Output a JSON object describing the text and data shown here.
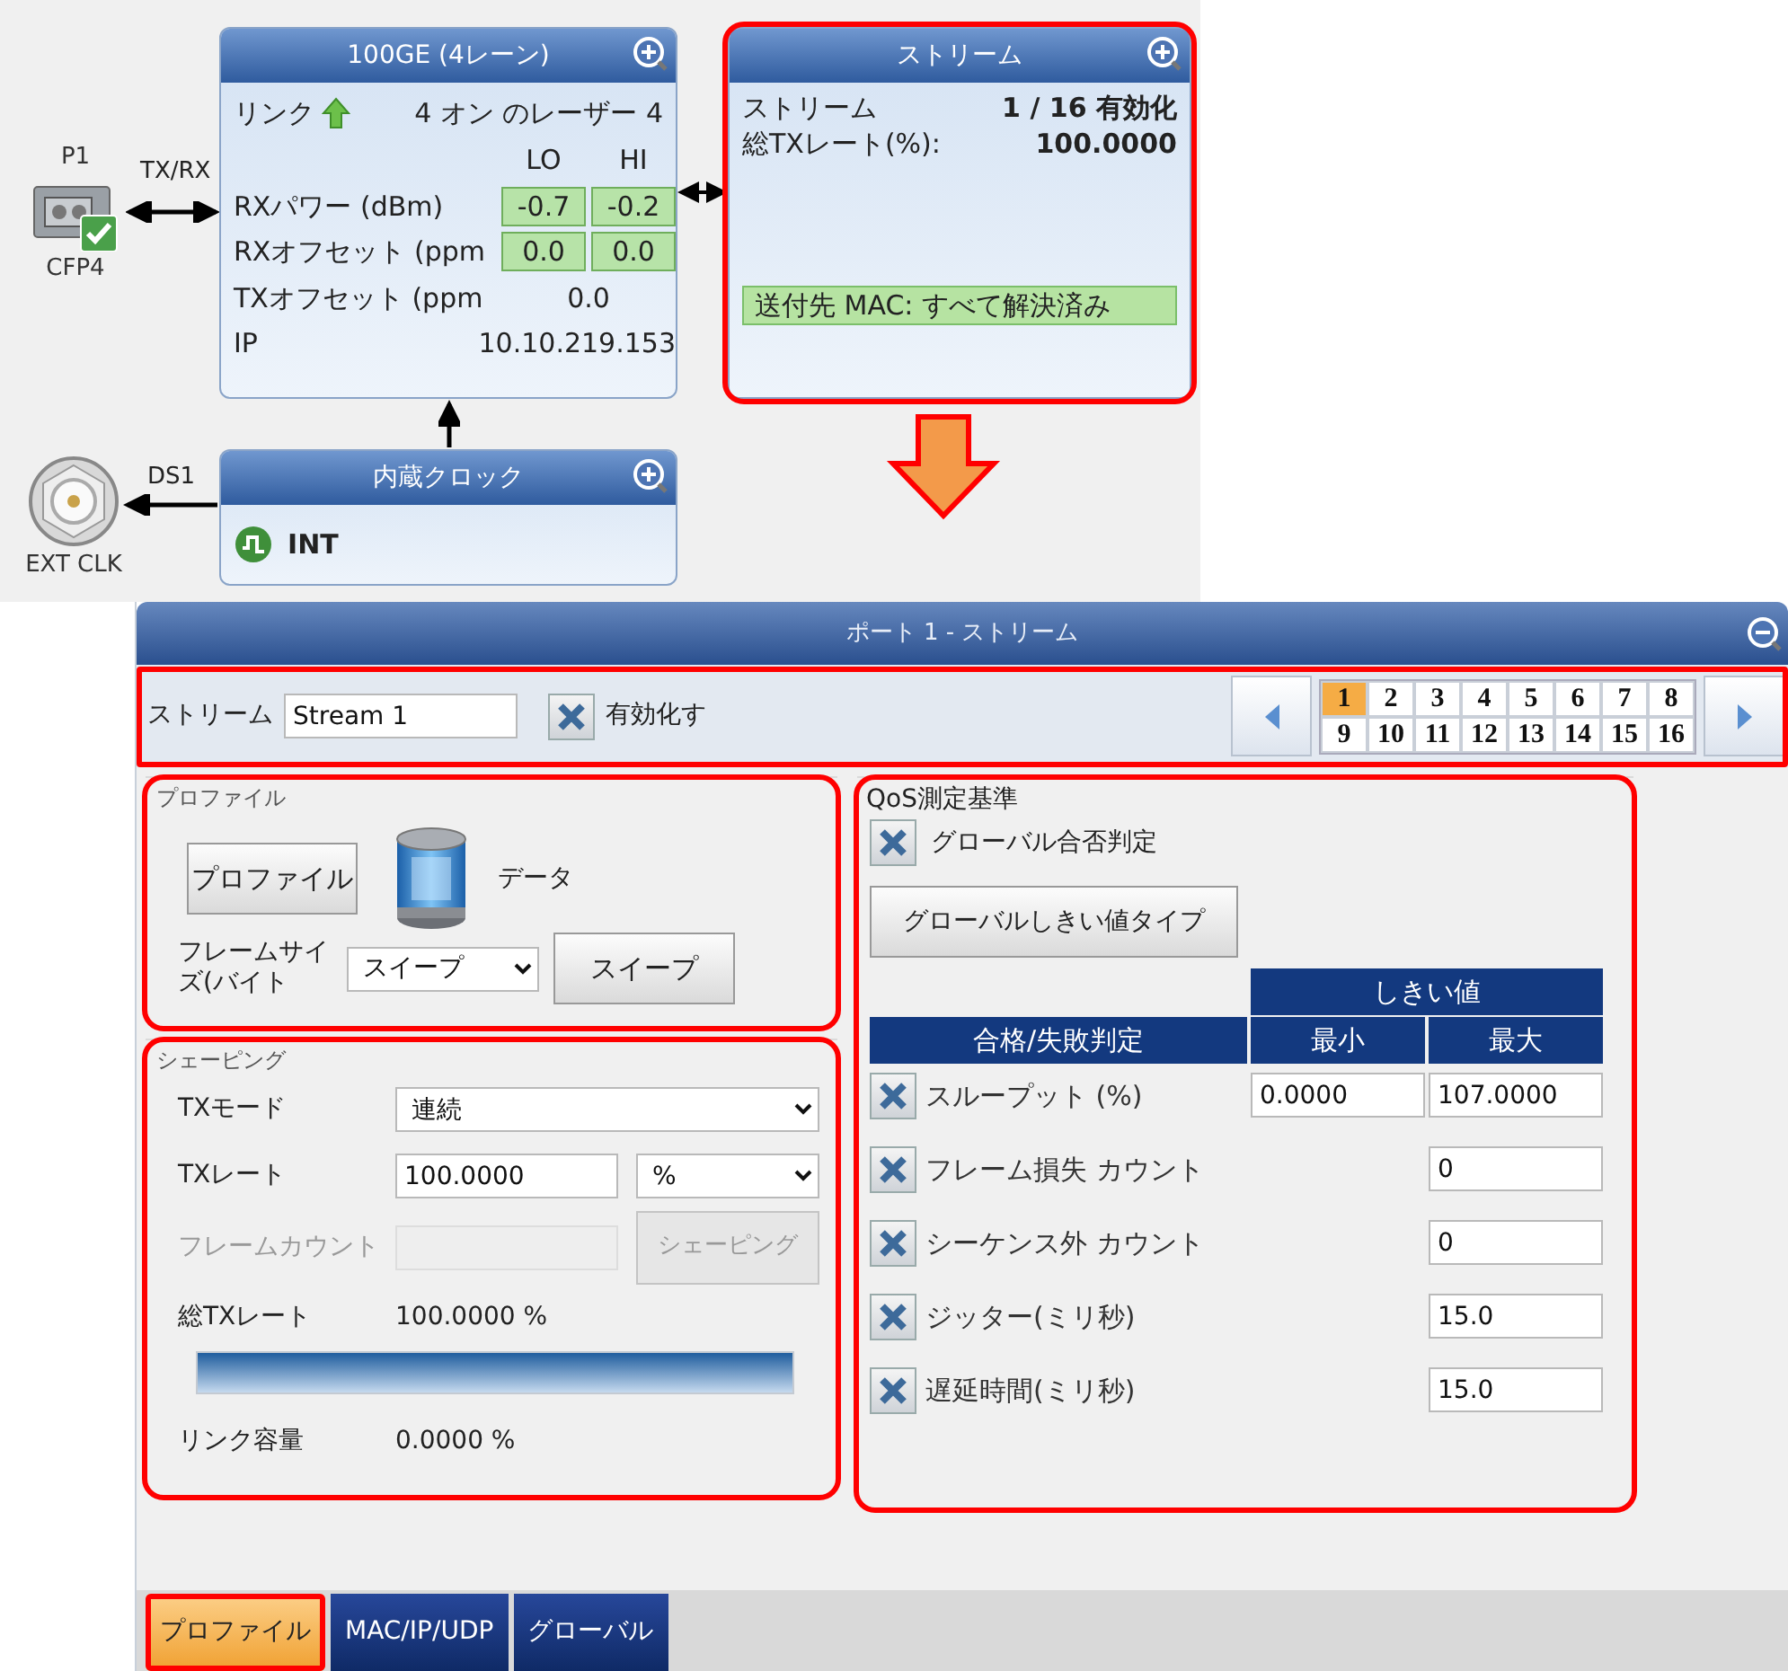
{
  "diagram": {
    "port": {
      "label": "P1",
      "type": "CFP4",
      "link": "TX/RX"
    },
    "interface": {
      "title": "100GE (4レーン)",
      "link_label": "リンク",
      "lasers": "4 オン のレーザー 4",
      "columns": [
        "LO",
        "HI"
      ],
      "rows": [
        {
          "label": "RXパワー (dBm)",
          "kind": "cells",
          "values": [
            "-0.7",
            "-0.2"
          ]
        },
        {
          "label": "RXオフセット (ppm",
          "kind": "cells",
          "values": [
            "0.0",
            "0.0"
          ]
        },
        {
          "label": "TXオフセット (ppm",
          "kind": "centered",
          "values": [
            "0.0"
          ]
        },
        {
          "label": "IP",
          "kind": "plain",
          "values": [
            "10.10.219.153"
          ]
        }
      ]
    },
    "stream": {
      "title": "ストリーム",
      "highlighted": true,
      "rows": [
        {
          "label": "ストリーム",
          "value": "1 / 16 有効化"
        },
        {
          "label": "総TXレート(%):",
          "value": "100.0000"
        }
      ],
      "status": "送付先 MAC: すべて解決済み"
    },
    "clock": {
      "title": "内蔵クロック",
      "value": "INT",
      "link": "DS1",
      "source": "EXT CLK"
    }
  },
  "panel": {
    "title": "ポート 1 - ストリーム",
    "stream_bar": {
      "highlighted": true,
      "label": "ストリーム",
      "name_value": "Stream 1",
      "enable": {
        "label": "有効化す",
        "checked": true
      },
      "pages": [
        {
          "label": "1",
          "selected": true
        },
        {
          "label": "2",
          "selected": false
        },
        {
          "label": "3",
          "selected": false
        },
        {
          "label": "4",
          "selected": false
        },
        {
          "label": "5",
          "selected": false
        },
        {
          "label": "6",
          "selected": false
        },
        {
          "label": "7",
          "selected": false
        },
        {
          "label": "8",
          "selected": false
        },
        {
          "label": "9",
          "selected": false
        },
        {
          "label": "10",
          "selected": false
        },
        {
          "label": "11",
          "selected": false
        },
        {
          "label": "12",
          "selected": false
        },
        {
          "label": "13",
          "selected": false
        },
        {
          "label": "14",
          "selected": false
        },
        {
          "label": "15",
          "selected": false
        },
        {
          "label": "16",
          "selected": false
        }
      ]
    },
    "profile": {
      "title": "プロファイル",
      "highlighted": true,
      "button": "プロファイル",
      "data_label": "データ",
      "frame_size": {
        "label": "フレームサイズ(バイト",
        "value": "スイープ",
        "button": "スイープ"
      }
    },
    "shaping": {
      "title": "シェーピング",
      "highlighted": true,
      "tx_mode": {
        "label": "TXモード",
        "value": "連続"
      },
      "tx_rate": {
        "label": "TXレート",
        "value": "100.0000",
        "unit": "%"
      },
      "frame_count": {
        "label": "フレームカウント",
        "disabled": true,
        "button": "シェーピング"
      },
      "total_rate": {
        "label": "総TXレート",
        "value": "100.0000 %",
        "level": 1
      },
      "link_capacity": {
        "label": "リンク容量",
        "value": "0.0000 %"
      }
    },
    "qos": {
      "title": "QoS測定基準",
      "highlighted": true,
      "global_pass_fail": {
        "label": "グローバル合否判定",
        "checked": true
      },
      "threshold_type_button": "グローバルしきい値タイプ",
      "threshold_header": "しきい値",
      "columns": [
        "合格/失敗判定",
        "最小",
        "最大"
      ],
      "rows": [
        {
          "label": "スループット (%)",
          "checked": true,
          "min": "0.0000",
          "max": "107.0000"
        },
        {
          "label": "フレーム損失 カウント",
          "checked": true,
          "max": "0"
        },
        {
          "label": "シーケンス外 カウント",
          "checked": true,
          "max": "0"
        },
        {
          "label": "ジッター(ミリ秒)",
          "checked": true,
          "max": "15.0"
        },
        {
          "label": "遅延時間(ミリ秒)",
          "checked": true,
          "max": "15.0"
        }
      ]
    },
    "tabs": [
      {
        "label": "プロファイル",
        "selected": true,
        "highlighted": true
      },
      {
        "label": "MAC/IP/UDP",
        "selected": false,
        "highlighted": false
      },
      {
        "label": "グローバル",
        "selected": false,
        "highlighted": false
      }
    ]
  }
}
